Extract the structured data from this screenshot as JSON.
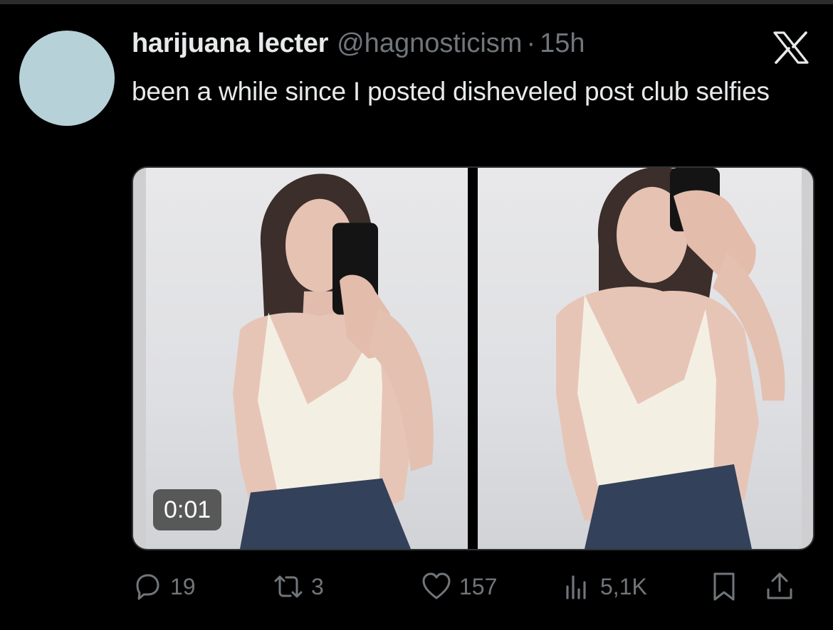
{
  "tweet": {
    "display_name": "harijuana lecter",
    "handle": "@hagnosticism",
    "separator": "·",
    "time": "15h",
    "text": "been a while since I posted disheveled post club selfies",
    "avatar_color": "#b7d1d8"
  },
  "media": {
    "video_duration": "0:01",
    "items": [
      "mirror-selfie-photo",
      "mirror-selfie-photo"
    ]
  },
  "actions": {
    "replies": "19",
    "reposts": "3",
    "likes": "157",
    "views": "5,1K"
  },
  "icons": {
    "brand": "x-logo-icon",
    "reply": "reply-icon",
    "retweet": "retweet-icon",
    "like": "heart-icon",
    "views": "views-chart-icon",
    "bookmark": "bookmark-icon",
    "share": "share-icon"
  },
  "colors": {
    "background": "#000000",
    "text_primary": "#e7e9ea",
    "text_secondary": "#71767b"
  }
}
